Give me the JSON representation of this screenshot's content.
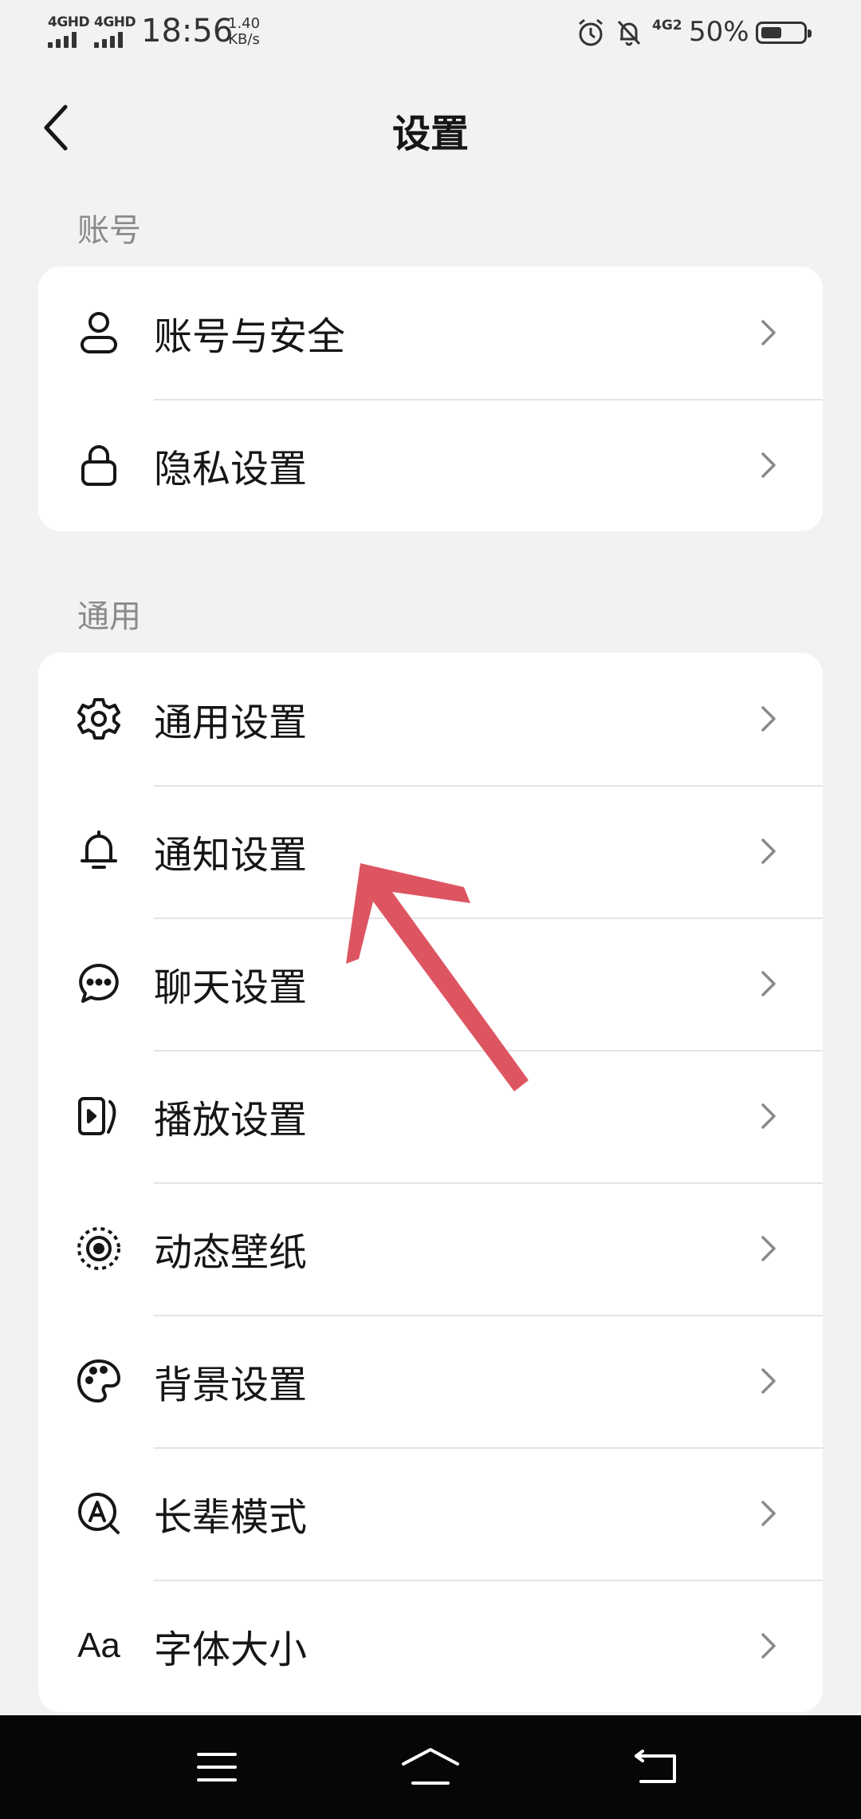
{
  "status_bar": {
    "sim1": "4GHD",
    "sim2": "4GHD",
    "time": "18:56",
    "speed_value": "1.40",
    "speed_unit": "KB/s",
    "network": "4G2",
    "battery_percent": "50%",
    "battery_level": 0.5,
    "icons": [
      "alarm-icon",
      "mute-bell-icon"
    ]
  },
  "header": {
    "back_icon": "chevron-left-icon",
    "title": "设置"
  },
  "sections": [
    {
      "label": "账号",
      "items": [
        {
          "icon": "user-icon",
          "label": "账号与安全"
        },
        {
          "icon": "lock-icon",
          "label": "隐私设置"
        }
      ]
    },
    {
      "label": "通用",
      "items": [
        {
          "icon": "gear-icon",
          "label": "通用设置"
        },
        {
          "icon": "bell-icon",
          "label": "通知设置"
        },
        {
          "icon": "chat-bubble-icon",
          "label": "聊天设置"
        },
        {
          "icon": "play-icon",
          "label": "播放设置"
        },
        {
          "icon": "live-wallpaper-icon",
          "label": "动态壁纸"
        },
        {
          "icon": "palette-icon",
          "label": "背景设置"
        },
        {
          "icon": "elder-mode-icon",
          "label": "长辈模式"
        },
        {
          "icon": "font-size-icon",
          "label": "字体大小",
          "icon_text": "Aa"
        }
      ]
    }
  ],
  "annotation": {
    "type": "arrow",
    "color": "#de5562"
  },
  "nav_bar": {
    "buttons": [
      "menu-icon",
      "home-icon",
      "back-icon"
    ]
  }
}
